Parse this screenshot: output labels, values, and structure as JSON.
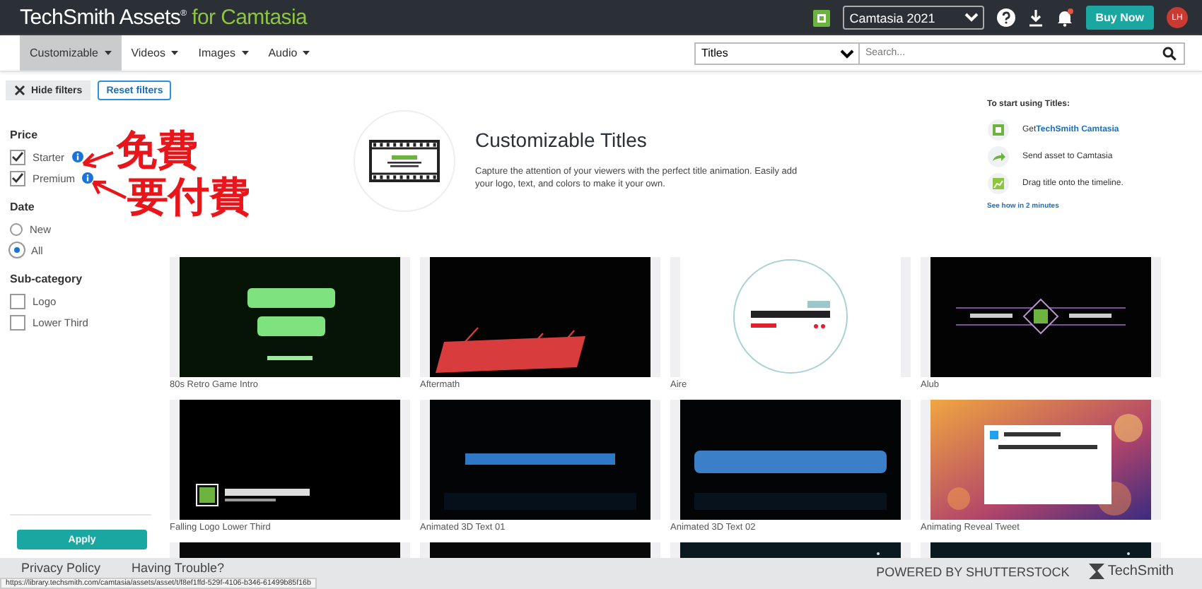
{
  "header": {
    "logo": "TechSmith Assets$^{®}$",
    "logo_suffix": "for Camtasia",
    "product": "Camtasia 2021",
    "buy_button": "Buy Now",
    "avatar": "LH"
  },
  "nav": [
    {
      "label": "Customizable",
      "selected": true
    },
    {
      "label": "Videos",
      "selected": false
    },
    {
      "label": "Images",
      "selected": false
    },
    {
      "label": "Audio",
      "selected": false
    }
  ],
  "search": {
    "category": "Titles",
    "placeholder": "Search..."
  },
  "filter_buttons": {
    "hide": "Hide filters",
    "reset": "Reset filters"
  },
  "filters": [
    {
      "title": "Price",
      "kind": "checkbox",
      "options": [
        {
          "label": "Starter",
          "checked": true,
          "info": true
        },
        {
          "label": "Premium",
          "checked": true,
          "info": true
        }
      ]
    },
    {
      "title": "Date",
      "kind": "radio",
      "options": [
        {
          "label": "New",
          "checked": false
        },
        {
          "label": "All",
          "checked": true
        }
      ]
    },
    {
      "title": "Sub-category",
      "kind": "checkbox",
      "options": [
        {
          "label": "Logo",
          "checked": false
        },
        {
          "label": "Lower Third",
          "checked": false
        }
      ]
    }
  ],
  "apply_button": "Apply",
  "hero": {
    "title": "Customizable Titles",
    "description": "Capture the attention of your viewers with the perfect title animation. Easily add your logo, text, and colors to make it your own."
  },
  "steps": {
    "heading": "To start using Titles:",
    "items": [
      {
        "text": "Get",
        "link": "TechSmith Camtasia"
      },
      {
        "text": "Send asset to Camtasia"
      },
      {
        "text": "Drag title onto the timeline."
      }
    ],
    "link": "See how in 2 minutes"
  },
  "assets": [
    {
      "label": "80s Retro Game Intro"
    },
    {
      "label": "Aftermath"
    },
    {
      "label": "Aire"
    },
    {
      "label": "Alub"
    },
    {
      "label": "Falling Logo Lower Third"
    },
    {
      "label": "Animated 3D Text 01"
    },
    {
      "label": "Animated 3D Text 02"
    },
    {
      "label": "Animating Reveal Tweet"
    },
    {
      "kind": "picture"
    },
    {
      "kind": "picture"
    },
    {
      "kind": "picture"
    },
    {
      "kind": "picture"
    }
  ],
  "footer": {
    "links": [
      "Privacy Policy",
      "Having Trouble?"
    ],
    "powered": "POWERED BY SHUTTERSTOCK",
    "brand": "TechSmith"
  },
  "status_url": "https://library.techsmith.com/camtasia/assets/asset/t/f8ef1ffd-529f-4106-b346-61499b85f16b",
  "annotations": [
    {
      "text": "免費"
    },
    {
      "text": "要付費"
    }
  ]
}
